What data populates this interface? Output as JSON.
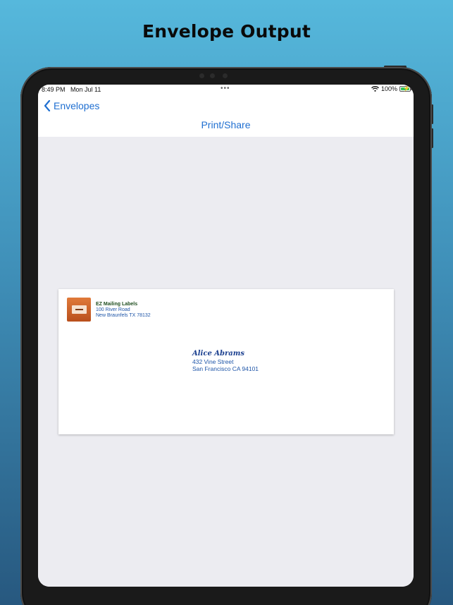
{
  "headline": "Envelope Output",
  "status_bar": {
    "time": "8:49 PM",
    "date": "Mon Jul 11",
    "battery_percent": "100%",
    "battery_level": 1.0,
    "multitasking_icon": "three-dots-icon",
    "wifi_icon": "wifi-icon",
    "battery_icon": "battery-charging-icon"
  },
  "navbar": {
    "back_label": "Envelopes",
    "back_icon": "chevron-left-icon",
    "action_label": "Print/Share"
  },
  "envelope": {
    "logo_icon": "envelope-logo-icon",
    "return_address": {
      "name": "EZ Mailing Labels",
      "line1": "100 River Road",
      "line2": "New Braunfels TX 78132"
    },
    "recipient": {
      "name": "Alice Abrams",
      "line1": "432 Vine Street",
      "line2": "San Francisco CA 94101"
    }
  },
  "colors": {
    "accent": "#1f6fd1",
    "address_text": "#1f56a8",
    "background_top": "#56b8dc",
    "background_bottom": "#27587f"
  }
}
